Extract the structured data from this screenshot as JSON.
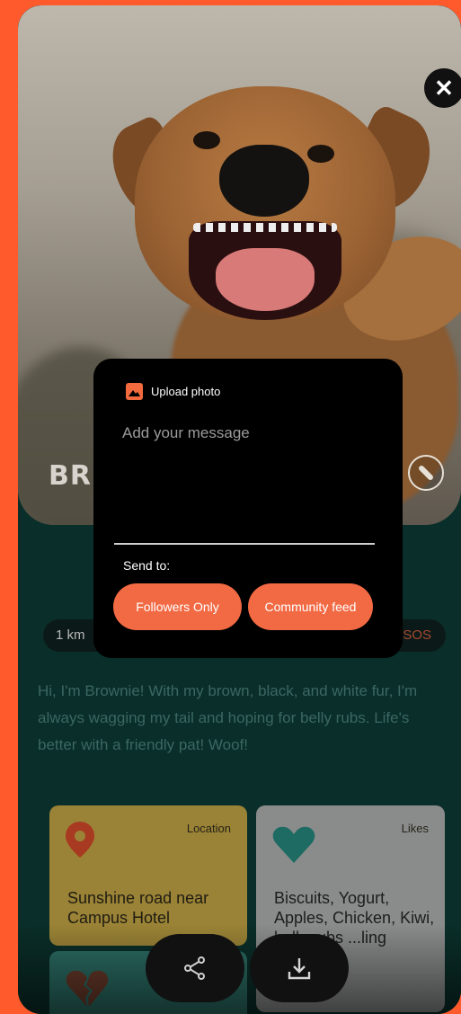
{
  "profile": {
    "name_partial": "BR",
    "distance": "1 km",
    "sos": "SOS",
    "bio": "Hi, I'm Brownie! With my brown, black, and white fur, I'm always wagging my tail and hoping for belly rubs. Life's better with a friendly pat! Woof!"
  },
  "tiles": {
    "location": {
      "label": "Location",
      "value": "Sunshine road near Campus Hotel",
      "color": "#9a8336"
    },
    "likes": {
      "label": "Likes",
      "value": "Biscuits, Yogurt, Apples, Chicken, Kiwi, belly rubs ...ling",
      "color": "#8a8c8b"
    }
  },
  "modal": {
    "upload_label": "Upload photo",
    "message_placeholder": "Add your message",
    "send_to_label": "Send to:",
    "followers_button": "Followers Only",
    "community_button": "Community feed",
    "accent": "#f26a44"
  },
  "icons": {
    "close": "close-icon",
    "edit": "pencil-icon",
    "share": "share-icon",
    "download": "download-icon",
    "location": "map-pin-icon",
    "likes": "heart-icon",
    "dislikes": "broken-heart-icon"
  },
  "colors": {
    "background": "#ff5a2c",
    "card": "#0a2e29"
  }
}
